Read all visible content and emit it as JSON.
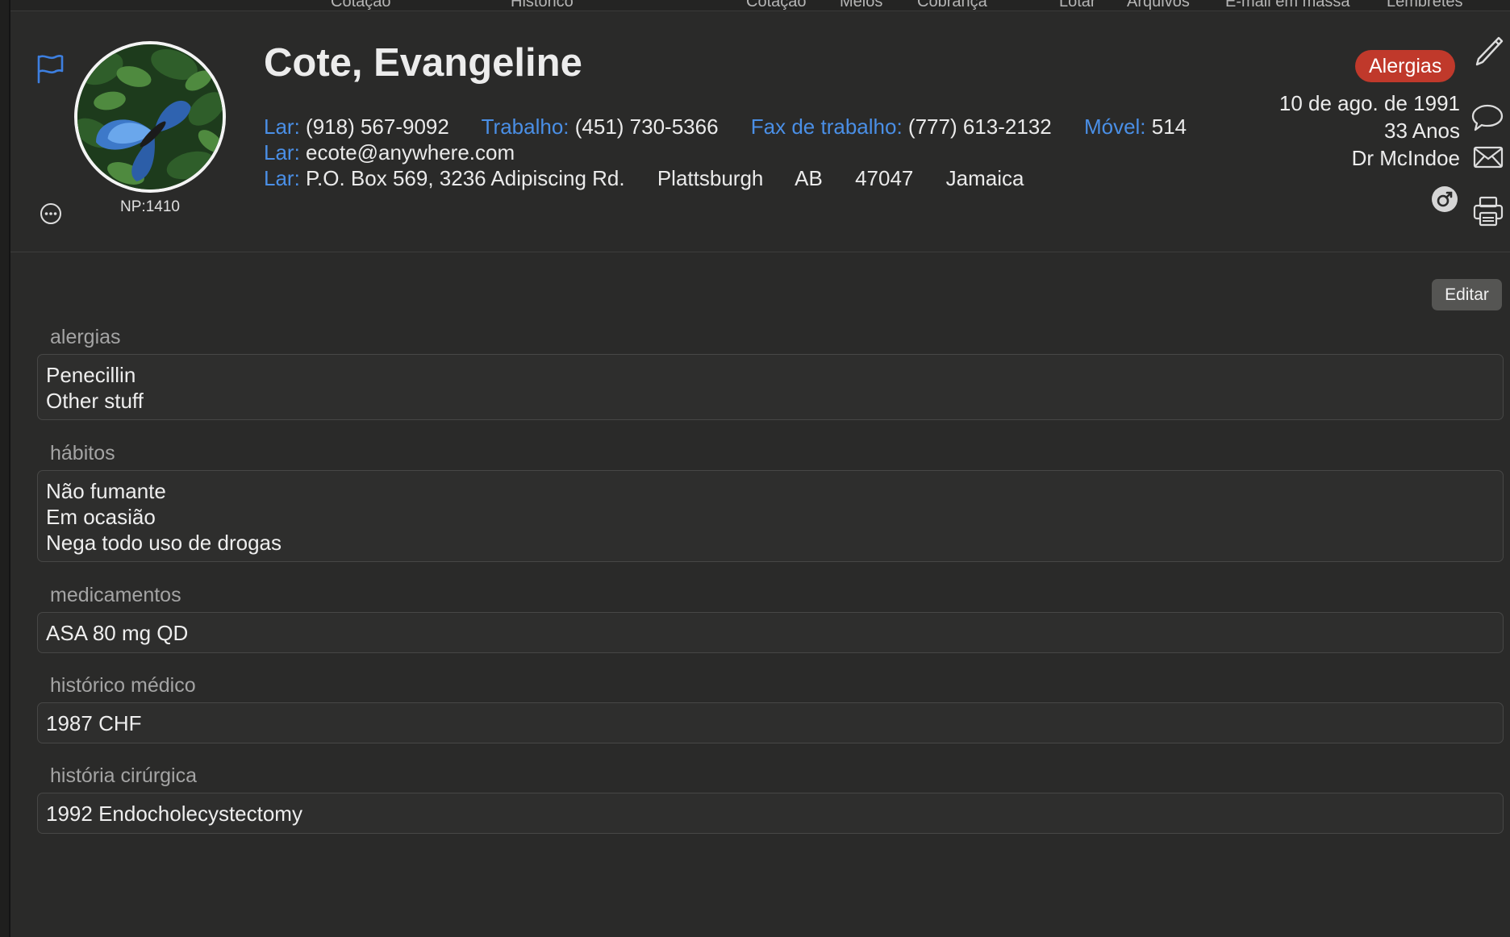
{
  "top_tabs": [
    "Cotação",
    "Histórico",
    "Cotação",
    "Meios",
    "Cobrança",
    "Lotar",
    "Arquivos",
    "E-mail em massa",
    "Lembretes"
  ],
  "patient": {
    "name": "Cote, Evangeline",
    "np": "NP:1410",
    "phones": [
      {
        "label": "Lar:",
        "value": "(918) 567-9092"
      },
      {
        "label": "Trabalho:",
        "value": "(451) 730-5366"
      },
      {
        "label": "Fax de trabalho:",
        "value": "(777) 613-2132"
      },
      {
        "label": "Móvel:",
        "value": "514"
      }
    ],
    "email": {
      "label": "Lar:",
      "value": "ecote@anywhere.com"
    },
    "address": {
      "label": "Lar:",
      "street": "P.O. Box 569, 3236 Adipiscing Rd.",
      "city": "Plattsburgh",
      "province": "AB",
      "postal": "47047",
      "country": "Jamaica"
    },
    "allergy_badge": "Alergias",
    "dob": "10 de ago. de 1991",
    "age": "33 Anos",
    "doctor": "Dr McIndoe"
  },
  "edit_label": "Editar",
  "sections": {
    "allergies": {
      "label": "alergias",
      "lines": [
        "Penecillin",
        "Other stuff"
      ]
    },
    "habits": {
      "label": "hábitos",
      "lines": [
        "Não fumante",
        "Em ocasião",
        "Nega todo uso de drogas"
      ]
    },
    "medications": {
      "label": "medicamentos",
      "lines": [
        "ASA 80 mg QD"
      ]
    },
    "medical_history": {
      "label": "histórico médico",
      "lines": [
        "1987 CHF"
      ]
    },
    "surgical_history": {
      "label": "história cirúrgica",
      "lines": [
        "1992 Endocholecystectomy"
      ]
    }
  },
  "colors": {
    "accent": "#4a8fe6",
    "badge": "#c0392b",
    "background": "#2a2a29"
  },
  "icons": [
    "flag-icon",
    "more-icon",
    "pencil-icon",
    "speech-bubble-icon",
    "mail-icon",
    "gender-male-icon",
    "printer-icon"
  ]
}
